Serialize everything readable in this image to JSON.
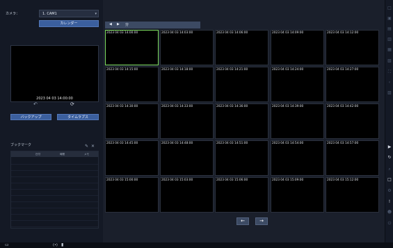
{
  "camera": {
    "label": "カメラ：",
    "value": "1. CAM1"
  },
  "calendar_button": "カレンダー",
  "preview": {
    "timestamp": "2023 04 03 14:00:00"
  },
  "buttons": {
    "backup": "バックアップ",
    "timelapse": "タイムラプス"
  },
  "bookmark": {
    "title": "ブックマーク",
    "columns": [
      "日付",
      "時間",
      "メモ"
    ]
  },
  "toolbar": {
    "prev": "◀",
    "next": "▶",
    "unit": "分"
  },
  "thumbnails": [
    [
      "2023 04 03 14:00:00",
      "2023 04 03 14:03:00",
      "2023 04 03 14:06:00",
      "2023 04 03 14:09:00",
      "2023 04 03 14:12:00"
    ],
    [
      "2023 04 03 14:15:00",
      "2023 04 03 14:18:00",
      "2023 04 03 14:21:00",
      "2023 04 03 14:24:00",
      "2023 04 03 14:27:00"
    ],
    [
      "2023 04 03 14:30:00",
      "2023 04 03 14:33:00",
      "2023 04 03 14:36:00",
      "2023 04 03 14:39:00",
      "2023 04 03 14:42:00"
    ],
    [
      "2023 04 03 14:45:00",
      "2023 04 03 14:48:00",
      "2023 04 03 14:51:00",
      "2023 04 03 14:54:00",
      "2023 04 03 14:57:00"
    ],
    [
      "2023 04 03 15:00:00",
      "2023 04 03 15:03:00",
      "2023 04 03 15:06:00",
      "2023 04 03 15:09:00",
      "2023 04 03 15:12:00"
    ]
  ],
  "selected_cell": [
    0,
    0
  ],
  "page_nav": {
    "prev": "←",
    "next": "→"
  },
  "right_toolbar": [
    {
      "icon": "layout-1-icon",
      "glyph": "□",
      "active": false
    },
    {
      "icon": "layout-4-icon",
      "glyph": "▣",
      "active": false
    },
    {
      "icon": "layout-9-icon",
      "glyph": "▤",
      "active": false
    },
    {
      "icon": "layout-16-icon",
      "glyph": "▥",
      "active": false
    },
    {
      "icon": "layout-custom-icon",
      "glyph": "▦",
      "active": false
    },
    {
      "icon": "sequence-icon",
      "glyph": "▧",
      "active": false
    },
    {
      "icon": "fullscreen-icon",
      "glyph": "⛶",
      "active": false
    },
    {
      "icon": "collapse-icon",
      "glyph": "‹",
      "active": false
    },
    {
      "icon": "grid-icon",
      "glyph": "▨",
      "active": false
    },
    {
      "icon": "play-icon",
      "glyph": "▶",
      "active": true
    },
    {
      "icon": "refresh-icon",
      "glyph": "↻",
      "active": true
    },
    {
      "icon": "search-icon",
      "glyph": "⌕",
      "active": false
    },
    {
      "icon": "window-icon",
      "glyph": "□",
      "active": true
    },
    {
      "icon": "settings-icon",
      "glyph": "⚙",
      "active": false
    },
    {
      "icon": "alert-icon",
      "glyph": "!",
      "active": true
    },
    {
      "icon": "user-icon",
      "glyph": "☻",
      "active": false
    },
    {
      "icon": "power-icon",
      "glyph": "⏻",
      "active": false
    }
  ],
  "bottom_bar": {
    "monitor": "▭",
    "audio": "(•)",
    "record": "▮"
  },
  "colors": {
    "selected_border": "#7ddc5e",
    "button_blue": "#3b5f9e",
    "toolbar": "#3c4a63"
  }
}
